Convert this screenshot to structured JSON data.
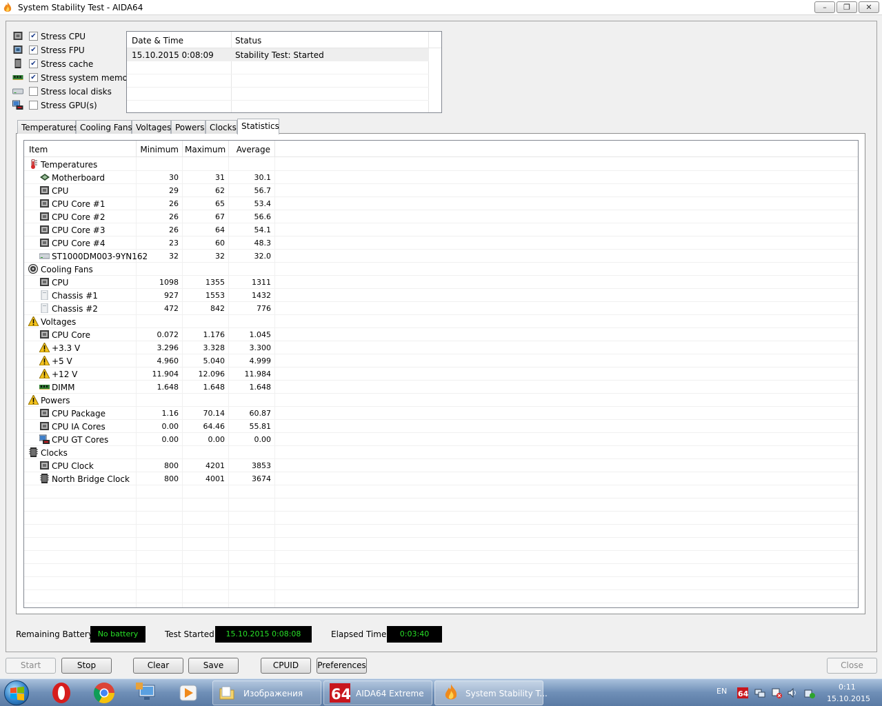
{
  "window": {
    "title": "System Stability Test - AIDA64",
    "controls": {
      "minimize": "–",
      "maximize": "❐",
      "close": "✕"
    }
  },
  "stress_options": [
    {
      "label": "Stress CPU",
      "checked": true,
      "icon": "cpu-icon"
    },
    {
      "label": "Stress FPU",
      "checked": true,
      "icon": "fpu-icon"
    },
    {
      "label": "Stress cache",
      "checked": true,
      "icon": "cache-icon"
    },
    {
      "label": "Stress system memory",
      "checked": true,
      "icon": "memory-icon"
    },
    {
      "label": "Stress local disks",
      "checked": false,
      "icon": "disk-icon"
    },
    {
      "label": "Stress GPU(s)",
      "checked": false,
      "icon": "gpu-icon"
    }
  ],
  "log": {
    "columns": [
      "Date & Time",
      "Status"
    ],
    "rows": [
      {
        "datetime": "15.10.2015 0:08:09",
        "status": "Stability Test: Started"
      }
    ]
  },
  "tabs": [
    {
      "label": "Temperatures",
      "active": false
    },
    {
      "label": "Cooling Fans",
      "active": false
    },
    {
      "label": "Voltages",
      "active": false
    },
    {
      "label": "Powers",
      "active": false
    },
    {
      "label": "Clocks",
      "active": false
    },
    {
      "label": "Statistics",
      "active": true
    }
  ],
  "statistics": {
    "columns": [
      "Item",
      "Minimum",
      "Maximum",
      "Average"
    ],
    "rows": [
      {
        "group": true,
        "icon": "thermometer-icon",
        "name": "Temperatures",
        "min": "",
        "max": "",
        "avg": ""
      },
      {
        "group": false,
        "icon": "motherboard-icon",
        "name": "Motherboard",
        "min": "30",
        "max": "31",
        "avg": "30.1"
      },
      {
        "group": false,
        "icon": "cpu-icon",
        "name": "CPU",
        "min": "29",
        "max": "62",
        "avg": "56.7"
      },
      {
        "group": false,
        "icon": "cpu-icon",
        "name": "CPU Core #1",
        "min": "26",
        "max": "65",
        "avg": "53.4"
      },
      {
        "group": false,
        "icon": "cpu-icon",
        "name": "CPU Core #2",
        "min": "26",
        "max": "67",
        "avg": "56.6"
      },
      {
        "group": false,
        "icon": "cpu-icon",
        "name": "CPU Core #3",
        "min": "26",
        "max": "64",
        "avg": "54.1"
      },
      {
        "group": false,
        "icon": "cpu-icon",
        "name": "CPU Core #4",
        "min": "23",
        "max": "60",
        "avg": "48.3"
      },
      {
        "group": false,
        "icon": "disk-icon",
        "name": "ST1000DM003-9YN162",
        "min": "32",
        "max": "32",
        "avg": "32.0"
      },
      {
        "group": true,
        "icon": "fan-icon",
        "name": "Cooling Fans",
        "min": "",
        "max": "",
        "avg": ""
      },
      {
        "group": false,
        "icon": "cpu-icon",
        "name": "CPU",
        "min": "1098",
        "max": "1355",
        "avg": "1311"
      },
      {
        "group": false,
        "icon": "chassis-icon",
        "name": "Chassis #1",
        "min": "927",
        "max": "1553",
        "avg": "1432"
      },
      {
        "group": false,
        "icon": "chassis-icon",
        "name": "Chassis #2",
        "min": "472",
        "max": "842",
        "avg": "776"
      },
      {
        "group": true,
        "icon": "warning-icon",
        "name": "Voltages",
        "min": "",
        "max": "",
        "avg": ""
      },
      {
        "group": false,
        "icon": "cpu-icon",
        "name": "CPU Core",
        "min": "0.072",
        "max": "1.176",
        "avg": "1.045"
      },
      {
        "group": false,
        "icon": "warning-icon",
        "name": "+3.3 V",
        "min": "3.296",
        "max": "3.328",
        "avg": "3.300"
      },
      {
        "group": false,
        "icon": "warning-icon",
        "name": "+5 V",
        "min": "4.960",
        "max": "5.040",
        "avg": "4.999"
      },
      {
        "group": false,
        "icon": "warning-icon",
        "name": "+12 V",
        "min": "11.904",
        "max": "12.096",
        "avg": "11.984"
      },
      {
        "group": false,
        "icon": "memory-icon",
        "name": "DIMM",
        "min": "1.648",
        "max": "1.648",
        "avg": "1.648"
      },
      {
        "group": true,
        "icon": "warning-icon",
        "name": "Powers",
        "min": "",
        "max": "",
        "avg": ""
      },
      {
        "group": false,
        "icon": "cpu-icon",
        "name": "CPU Package",
        "min": "1.16",
        "max": "70.14",
        "avg": "60.87"
      },
      {
        "group": false,
        "icon": "cpu-icon",
        "name": "CPU IA Cores",
        "min": "0.00",
        "max": "64.46",
        "avg": "55.81"
      },
      {
        "group": false,
        "icon": "gpu-icon",
        "name": "CPU GT Cores",
        "min": "0.00",
        "max": "0.00",
        "avg": "0.00"
      },
      {
        "group": true,
        "icon": "chip-icon",
        "name": "Clocks",
        "min": "",
        "max": "",
        "avg": ""
      },
      {
        "group": false,
        "icon": "cpu-icon",
        "name": "CPU Clock",
        "min": "800",
        "max": "4201",
        "avg": "3853"
      },
      {
        "group": false,
        "icon": "chip-icon",
        "name": "North Bridge Clock",
        "min": "800",
        "max": "4001",
        "avg": "3674"
      }
    ]
  },
  "status": {
    "battery_label": "Remaining Battery:",
    "battery_value": "No battery",
    "started_label": "Test Started:",
    "started_value": "15.10.2015 0:08:08",
    "elapsed_label": "Elapsed Time:",
    "elapsed_value": "0:03:40"
  },
  "buttons": {
    "start": "Start",
    "stop": "Stop",
    "clear": "Clear",
    "save": "Save",
    "cpuid": "CPUID",
    "preferences": "Preferences",
    "close": "Close"
  },
  "taskbar": {
    "tasks": [
      {
        "label": "Изображения",
        "icon": "folder-icon",
        "active": false
      },
      {
        "label": "AIDA64 Extreme",
        "icon": "aida64-icon",
        "active": false
      },
      {
        "label": "System Stability T...",
        "icon": "flame-icon",
        "active": true
      }
    ],
    "lang": "EN",
    "time": "0:11",
    "date": "15.10.2015"
  },
  "colors": {
    "lcd_text": "#27e027",
    "lcd_bg": "#000000",
    "taskbar": "#6f8fb7"
  }
}
